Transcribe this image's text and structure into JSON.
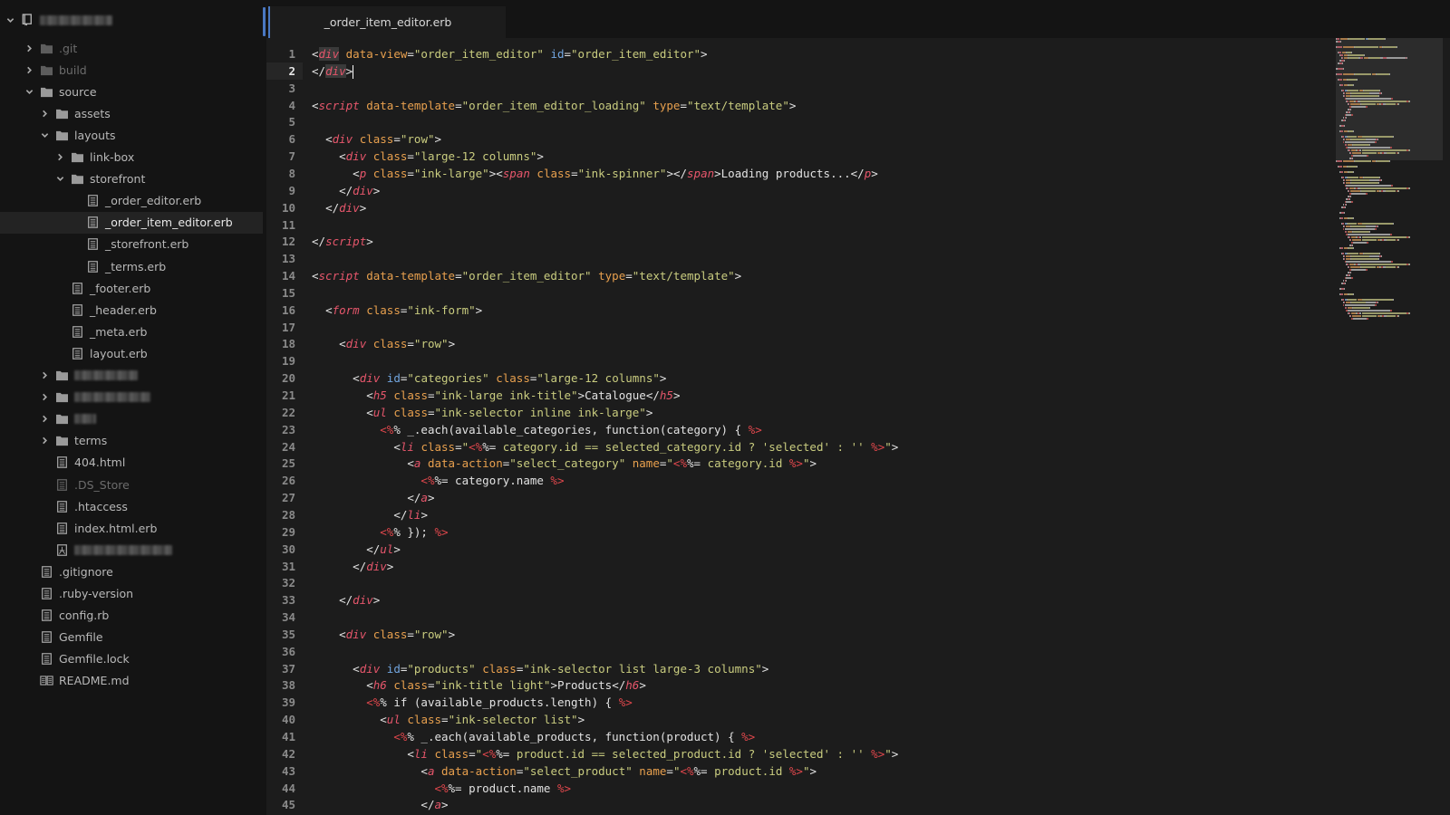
{
  "sidebar": {
    "project_name": "blurred-project-name",
    "items": [
      {
        "label": ".git",
        "type": "folder",
        "depth": 1,
        "expanded": false,
        "dim": true
      },
      {
        "label": "build",
        "type": "folder",
        "depth": 1,
        "expanded": false,
        "dim": true
      },
      {
        "label": "source",
        "type": "folder",
        "depth": 1,
        "expanded": true
      },
      {
        "label": "assets",
        "type": "folder",
        "depth": 2,
        "expanded": false
      },
      {
        "label": "layouts",
        "type": "folder",
        "depth": 2,
        "expanded": true
      },
      {
        "label": "link-box",
        "type": "folder",
        "depth": 3,
        "expanded": false
      },
      {
        "label": "storefront",
        "type": "folder",
        "depth": 3,
        "expanded": true
      },
      {
        "label": "_order_editor.erb",
        "type": "file",
        "depth": 4
      },
      {
        "label": "_order_item_editor.erb",
        "type": "file",
        "depth": 4,
        "selected": true
      },
      {
        "label": "_storefront.erb",
        "type": "file",
        "depth": 4
      },
      {
        "label": "_terms.erb",
        "type": "file",
        "depth": 4
      },
      {
        "label": "_footer.erb",
        "type": "file",
        "depth": 3
      },
      {
        "label": "_header.erb",
        "type": "file",
        "depth": 3
      },
      {
        "label": "_meta.erb",
        "type": "file",
        "depth": 3
      },
      {
        "label": "layout.erb",
        "type": "file",
        "depth": 3
      },
      {
        "label": "",
        "type": "folder",
        "depth": 2,
        "expanded": false,
        "blurred": 70
      },
      {
        "label": "",
        "type": "folder",
        "depth": 2,
        "expanded": false,
        "blurred": 84
      },
      {
        "label": "",
        "type": "folder",
        "depth": 2,
        "expanded": false,
        "blurred": 24
      },
      {
        "label": "terms",
        "type": "folder",
        "depth": 2,
        "expanded": false
      },
      {
        "label": "404.html",
        "type": "file",
        "depth": 2
      },
      {
        "label": ".DS_Store",
        "type": "file",
        "depth": 2,
        "dim": true
      },
      {
        "label": ".htaccess",
        "type": "file",
        "depth": 2
      },
      {
        "label": "index.html.erb",
        "type": "file",
        "depth": 2
      },
      {
        "label": "",
        "type": "pdf",
        "depth": 2,
        "blurred": 108
      },
      {
        "label": ".gitignore",
        "type": "file",
        "depth": 1
      },
      {
        "label": ".ruby-version",
        "type": "file",
        "depth": 1
      },
      {
        "label": "config.rb",
        "type": "file",
        "depth": 1
      },
      {
        "label": "Gemfile",
        "type": "file",
        "depth": 1
      },
      {
        "label": "Gemfile.lock",
        "type": "file",
        "depth": 1
      },
      {
        "label": "README.md",
        "type": "book",
        "depth": 1
      }
    ]
  },
  "tabs": [
    {
      "label": "_order_item_editor.erb",
      "active": true
    }
  ],
  "editor": {
    "active_line": 2,
    "lines": [
      [
        [
          "p",
          "<"
        ],
        [
          "tag",
          "div",
          "hl"
        ],
        [
          "t",
          " "
        ],
        [
          "a",
          "data-view"
        ],
        [
          "p",
          "="
        ],
        [
          "s",
          "\"order_item_editor\""
        ],
        [
          "t",
          " "
        ],
        [
          "id",
          "id"
        ],
        [
          "p",
          "="
        ],
        [
          "s",
          "\"order_item_editor\""
        ],
        [
          "p",
          ">"
        ]
      ],
      [
        [
          "p",
          "</"
        ],
        [
          "tag",
          "div",
          "hl"
        ],
        [
          "p",
          ">"
        ],
        [
          "cursor",
          ""
        ]
      ],
      [],
      [
        [
          "p",
          "<"
        ],
        [
          "tag",
          "script"
        ],
        [
          "t",
          " "
        ],
        [
          "a",
          "data-template"
        ],
        [
          "p",
          "="
        ],
        [
          "s",
          "\"order_item_editor_loading\""
        ],
        [
          "t",
          " "
        ],
        [
          "a",
          "type"
        ],
        [
          "p",
          "="
        ],
        [
          "s",
          "\"text/template\""
        ],
        [
          "p",
          ">"
        ]
      ],
      [],
      [
        [
          "t",
          "  "
        ],
        [
          "p",
          "<"
        ],
        [
          "tag",
          "div"
        ],
        [
          "t",
          " "
        ],
        [
          "a",
          "class"
        ],
        [
          "p",
          "="
        ],
        [
          "s",
          "\"row\""
        ],
        [
          "p",
          ">"
        ]
      ],
      [
        [
          "t",
          "    "
        ],
        [
          "p",
          "<"
        ],
        [
          "tag",
          "div"
        ],
        [
          "t",
          " "
        ],
        [
          "a",
          "class"
        ],
        [
          "p",
          "="
        ],
        [
          "s",
          "\"large-12 columns\""
        ],
        [
          "p",
          ">"
        ]
      ],
      [
        [
          "t",
          "      "
        ],
        [
          "p",
          "<"
        ],
        [
          "tag",
          "p"
        ],
        [
          "t",
          " "
        ],
        [
          "a",
          "class"
        ],
        [
          "p",
          "="
        ],
        [
          "s",
          "\"ink-large\""
        ],
        [
          "p",
          ">"
        ],
        [
          "p",
          "<"
        ],
        [
          "tag",
          "span"
        ],
        [
          "t",
          " "
        ],
        [
          "a",
          "class"
        ],
        [
          "p",
          "="
        ],
        [
          "s",
          "\"ink-spinner\""
        ],
        [
          "p",
          "></"
        ],
        [
          "tag",
          "span"
        ],
        [
          "p",
          ">"
        ],
        [
          "t",
          "Loading products..."
        ],
        [
          "p",
          "</"
        ],
        [
          "tag",
          "p"
        ],
        [
          "p",
          ">"
        ]
      ],
      [
        [
          "t",
          "    "
        ],
        [
          "p",
          "</"
        ],
        [
          "tag",
          "div"
        ],
        [
          "p",
          ">"
        ]
      ],
      [
        [
          "t",
          "  "
        ],
        [
          "p",
          "</"
        ],
        [
          "tag",
          "div"
        ],
        [
          "p",
          ">"
        ]
      ],
      [],
      [
        [
          "p",
          "</"
        ],
        [
          "tag",
          "script"
        ],
        [
          "p",
          ">"
        ]
      ],
      [],
      [
        [
          "p",
          "<"
        ],
        [
          "tag",
          "script"
        ],
        [
          "t",
          " "
        ],
        [
          "a",
          "data-template"
        ],
        [
          "p",
          "="
        ],
        [
          "s",
          "\"order_item_editor\""
        ],
        [
          "t",
          " "
        ],
        [
          "a",
          "type"
        ],
        [
          "p",
          "="
        ],
        [
          "s",
          "\"text/template\""
        ],
        [
          "p",
          ">"
        ]
      ],
      [],
      [
        [
          "t",
          "  "
        ],
        [
          "p",
          "<"
        ],
        [
          "tag",
          "form"
        ],
        [
          "t",
          " "
        ],
        [
          "a",
          "class"
        ],
        [
          "p",
          "="
        ],
        [
          "s",
          "\"ink-form\""
        ],
        [
          "p",
          ">"
        ]
      ],
      [],
      [
        [
          "t",
          "    "
        ],
        [
          "p",
          "<"
        ],
        [
          "tag",
          "div"
        ],
        [
          "t",
          " "
        ],
        [
          "a",
          "class"
        ],
        [
          "p",
          "="
        ],
        [
          "s",
          "\"row\""
        ],
        [
          "p",
          ">"
        ]
      ],
      [],
      [
        [
          "t",
          "      "
        ],
        [
          "p",
          "<"
        ],
        [
          "tag",
          "div"
        ],
        [
          "t",
          " "
        ],
        [
          "id",
          "id"
        ],
        [
          "p",
          "="
        ],
        [
          "s",
          "\"categories\""
        ],
        [
          "t",
          " "
        ],
        [
          "a",
          "class"
        ],
        [
          "p",
          "="
        ],
        [
          "s",
          "\"large-12 columns\""
        ],
        [
          "p",
          ">"
        ]
      ],
      [
        [
          "t",
          "        "
        ],
        [
          "p",
          "<"
        ],
        [
          "tag",
          "h5"
        ],
        [
          "t",
          " "
        ],
        [
          "a",
          "class"
        ],
        [
          "p",
          "="
        ],
        [
          "s",
          "\"ink-large ink-title\""
        ],
        [
          "p",
          ">"
        ],
        [
          "t",
          "Catalogue"
        ],
        [
          "p",
          "</"
        ],
        [
          "tag",
          "h5"
        ],
        [
          "p",
          ">"
        ]
      ],
      [
        [
          "t",
          "        "
        ],
        [
          "p",
          "<"
        ],
        [
          "tag",
          "ul"
        ],
        [
          "t",
          " "
        ],
        [
          "a",
          "class"
        ],
        [
          "p",
          "="
        ],
        [
          "s",
          "\"ink-selector inline ink-large\""
        ],
        [
          "p",
          ">"
        ]
      ],
      [
        [
          "t",
          "          "
        ],
        [
          "e",
          "<%"
        ],
        [
          "t",
          "% _.each(available_categories, function(category) { "
        ],
        [
          "e",
          "%>"
        ]
      ],
      [
        [
          "t",
          "            "
        ],
        [
          "p",
          "<"
        ],
        [
          "tag",
          "li"
        ],
        [
          "t",
          " "
        ],
        [
          "a",
          "class"
        ],
        [
          "p",
          "="
        ],
        [
          "s",
          "\""
        ],
        [
          "e",
          "<%"
        ],
        [
          "t",
          "%= "
        ],
        [
          "s",
          "category.id == selected_category.id ? 'selected' : '' "
        ],
        [
          "e",
          "%>"
        ],
        [
          "s",
          "\""
        ],
        [
          "p",
          ">"
        ]
      ],
      [
        [
          "t",
          "              "
        ],
        [
          "p",
          "<"
        ],
        [
          "tag",
          "a"
        ],
        [
          "t",
          " "
        ],
        [
          "a",
          "data-action"
        ],
        [
          "p",
          "="
        ],
        [
          "s",
          "\"select_category\""
        ],
        [
          "t",
          " "
        ],
        [
          "a",
          "name"
        ],
        [
          "p",
          "="
        ],
        [
          "s",
          "\""
        ],
        [
          "e",
          "<%"
        ],
        [
          "t",
          "%= "
        ],
        [
          "s",
          "category.id "
        ],
        [
          "e",
          "%>"
        ],
        [
          "s",
          "\""
        ],
        [
          "p",
          ">"
        ]
      ],
      [
        [
          "t",
          "                "
        ],
        [
          "e",
          "<%"
        ],
        [
          "t",
          "%= category.name "
        ],
        [
          "e",
          "%>"
        ]
      ],
      [
        [
          "t",
          "              "
        ],
        [
          "p",
          "</"
        ],
        [
          "tag",
          "a"
        ],
        [
          "p",
          ">"
        ]
      ],
      [
        [
          "t",
          "            "
        ],
        [
          "p",
          "</"
        ],
        [
          "tag",
          "li"
        ],
        [
          "p",
          ">"
        ]
      ],
      [
        [
          "t",
          "          "
        ],
        [
          "e",
          "<%"
        ],
        [
          "t",
          "% }); "
        ],
        [
          "e",
          "%>"
        ]
      ],
      [
        [
          "t",
          "        "
        ],
        [
          "p",
          "</"
        ],
        [
          "tag",
          "ul"
        ],
        [
          "p",
          ">"
        ]
      ],
      [
        [
          "t",
          "      "
        ],
        [
          "p",
          "</"
        ],
        [
          "tag",
          "div"
        ],
        [
          "p",
          ">"
        ]
      ],
      [],
      [
        [
          "t",
          "    "
        ],
        [
          "p",
          "</"
        ],
        [
          "tag",
          "div"
        ],
        [
          "p",
          ">"
        ]
      ],
      [],
      [
        [
          "t",
          "    "
        ],
        [
          "p",
          "<"
        ],
        [
          "tag",
          "div"
        ],
        [
          "t",
          " "
        ],
        [
          "a",
          "class"
        ],
        [
          "p",
          "="
        ],
        [
          "s",
          "\"row\""
        ],
        [
          "p",
          ">"
        ]
      ],
      [],
      [
        [
          "t",
          "      "
        ],
        [
          "p",
          "<"
        ],
        [
          "tag",
          "div"
        ],
        [
          "t",
          " "
        ],
        [
          "id",
          "id"
        ],
        [
          "p",
          "="
        ],
        [
          "s",
          "\"products\""
        ],
        [
          "t",
          " "
        ],
        [
          "a",
          "class"
        ],
        [
          "p",
          "="
        ],
        [
          "s",
          "\"ink-selector list large-3 columns\""
        ],
        [
          "p",
          ">"
        ]
      ],
      [
        [
          "t",
          "        "
        ],
        [
          "p",
          "<"
        ],
        [
          "tag",
          "h6"
        ],
        [
          "t",
          " "
        ],
        [
          "a",
          "class"
        ],
        [
          "p",
          "="
        ],
        [
          "s",
          "\"ink-title light\""
        ],
        [
          "p",
          ">"
        ],
        [
          "t",
          "Products"
        ],
        [
          "p",
          "</"
        ],
        [
          "tag",
          "h6"
        ],
        [
          "p",
          ">"
        ]
      ],
      [
        [
          "t",
          "        "
        ],
        [
          "e",
          "<%"
        ],
        [
          "t",
          "% if (available_products.length) { "
        ],
        [
          "e",
          "%>"
        ]
      ],
      [
        [
          "t",
          "          "
        ],
        [
          "p",
          "<"
        ],
        [
          "tag",
          "ul"
        ],
        [
          "t",
          " "
        ],
        [
          "a",
          "class"
        ],
        [
          "p",
          "="
        ],
        [
          "s",
          "\"ink-selector list\""
        ],
        [
          "p",
          ">"
        ]
      ],
      [
        [
          "t",
          "            "
        ],
        [
          "e",
          "<%"
        ],
        [
          "t",
          "% _.each(available_products, function(product) { "
        ],
        [
          "e",
          "%>"
        ]
      ],
      [
        [
          "t",
          "              "
        ],
        [
          "p",
          "<"
        ],
        [
          "tag",
          "li"
        ],
        [
          "t",
          " "
        ],
        [
          "a",
          "class"
        ],
        [
          "p",
          "="
        ],
        [
          "s",
          "\""
        ],
        [
          "e",
          "<%"
        ],
        [
          "t",
          "%= "
        ],
        [
          "s",
          "product.id == selected_product.id ? 'selected' : '' "
        ],
        [
          "e",
          "%>"
        ],
        [
          "s",
          "\""
        ],
        [
          "p",
          ">"
        ]
      ],
      [
        [
          "t",
          "                "
        ],
        [
          "p",
          "<"
        ],
        [
          "tag",
          "a"
        ],
        [
          "t",
          " "
        ],
        [
          "a",
          "data-action"
        ],
        [
          "p",
          "="
        ],
        [
          "s",
          "\"select_product\""
        ],
        [
          "t",
          " "
        ],
        [
          "a",
          "name"
        ],
        [
          "p",
          "="
        ],
        [
          "s",
          "\""
        ],
        [
          "e",
          "<%"
        ],
        [
          "t",
          "%= "
        ],
        [
          "s",
          "product.id "
        ],
        [
          "e",
          "%>"
        ],
        [
          "s",
          "\""
        ],
        [
          "p",
          ">"
        ]
      ],
      [
        [
          "t",
          "                  "
        ],
        [
          "e",
          "<%"
        ],
        [
          "t",
          "%= product.name "
        ],
        [
          "e",
          "%>"
        ]
      ],
      [
        [
          "t",
          "                "
        ],
        [
          "p",
          "</"
        ],
        [
          "tag",
          "a"
        ],
        [
          "p",
          ">"
        ]
      ]
    ]
  },
  "colors": {
    "accent": "#4a78c2",
    "tag": "#e5566b",
    "attribute": "#e8a04e",
    "id_attribute": "#72a6e0",
    "string": "#c9cc7f",
    "erb_delimiter": "#e0474c",
    "text": "#e2e2e2"
  }
}
